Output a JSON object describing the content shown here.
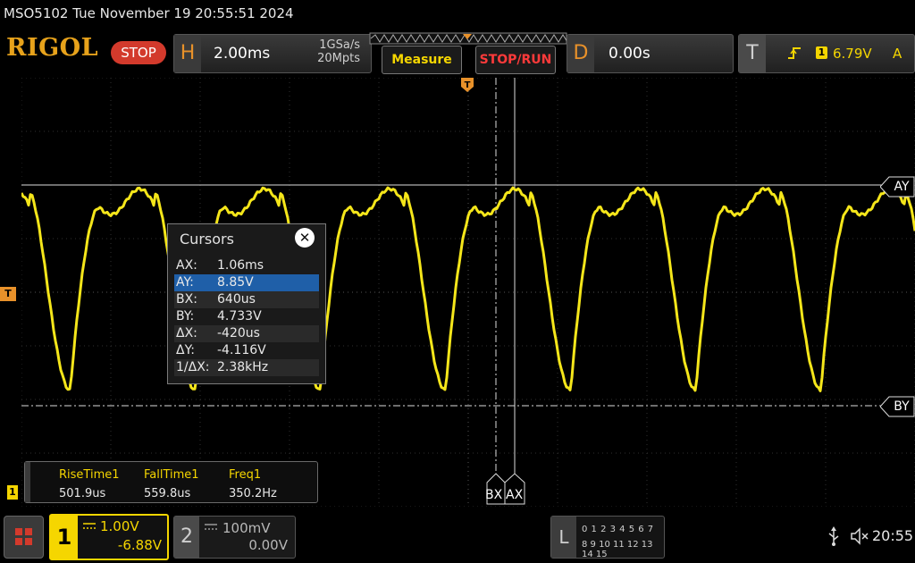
{
  "status": {
    "text": "MSO5102  Tue November 19 20:55:51 2024"
  },
  "toolbar": {
    "brand": "RIGOL",
    "run_state": "STOP",
    "horizontal": {
      "letter": "H",
      "timebase": "2.00ms",
      "sample_rate": "1GSa/s",
      "memory_depth": "20Mpts"
    },
    "measure_label": "Measure",
    "stoprun_label": "STOP/RUN",
    "delay": {
      "letter": "D",
      "value": "0.00s"
    },
    "trigger": {
      "letter": "T",
      "channel": "1",
      "level": "6.79V",
      "mode": "A",
      "slope_icon": "rising-edge-icon"
    }
  },
  "cursor_markers": {
    "ay": "AY",
    "by": "BY",
    "bx": "BX",
    "ax": "AX",
    "trigger_level": "T",
    "channel1_ground": "1"
  },
  "cursors": {
    "title": "Cursors",
    "rows": [
      {
        "key": "AX:",
        "value": "1.06ms"
      },
      {
        "key": "AY:",
        "value": "8.85V"
      },
      {
        "key": "BX:",
        "value": "640us"
      },
      {
        "key": "BY:",
        "value": "4.733V"
      },
      {
        "key": "ΔX:",
        "value": "-420us"
      },
      {
        "key": "ΔY:",
        "value": "-4.116V"
      },
      {
        "key": "1/ΔX:",
        "value": "2.38kHz"
      }
    ],
    "selected_row": 1
  },
  "measurements": [
    {
      "label": "RiseTime1",
      "value": "501.9us"
    },
    {
      "label": "FallTime1",
      "value": "559.8us"
    },
    {
      "label": "Freq1",
      "value": "350.2Hz"
    }
  ],
  "channels": {
    "ch1": {
      "number": "1",
      "scale": "1.00V",
      "offset": "-6.88V",
      "color": "#f5d600"
    },
    "ch2": {
      "number": "2",
      "scale": "100mV",
      "offset": "0.00V",
      "color": "#cfcfcf"
    }
  },
  "logic": {
    "label": "L",
    "row1": "0 1 2 3  4 5 6 7",
    "row2": "8 9 10 11 12 13 14 15"
  },
  "system": {
    "clock": "20:55",
    "usb_icon": "usb-icon",
    "mute_icon": "speaker-mute-icon",
    "menu_icon": "menu-grid-icon"
  },
  "colors": {
    "accent_orange": "#e8912a",
    "ch1_yellow": "#f5d600",
    "stop_red": "#d33a2c",
    "cursor_highlight": "#1f5fa8"
  }
}
